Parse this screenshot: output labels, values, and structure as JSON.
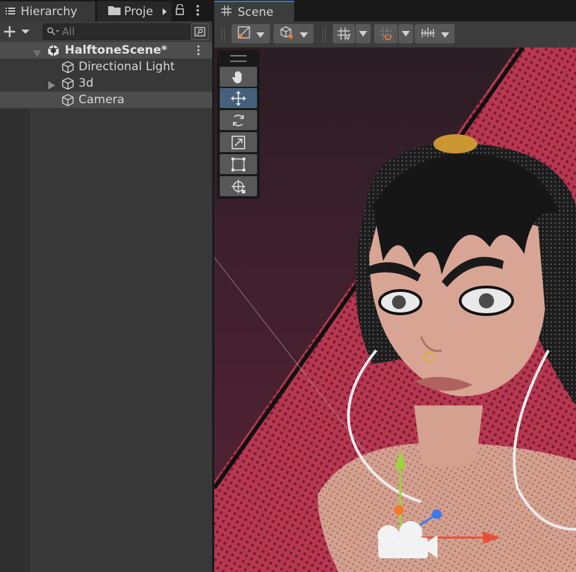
{
  "hierarchy": {
    "tab_label": "Hierarchy",
    "project_tab_label": "Proje",
    "search_placeholder": "All",
    "scene_name": "HalftoneScene*",
    "items": [
      {
        "label": "Directional Light"
      },
      {
        "label": "3d"
      },
      {
        "label": "Camera"
      }
    ]
  },
  "scene": {
    "tab_label": "Scene"
  },
  "icons": {
    "hierarchy_tab": "list-icon",
    "project_tab": "folder-icon",
    "scene_tab": "hash-icon",
    "lock": "lock-icon",
    "more": "kebab-icon",
    "add": "plus-icon",
    "search": "search-icon",
    "unity_scene": "unity-logo-icon",
    "gameobject": "cube-icon",
    "tools": [
      "hand-tool-icon",
      "move-tool-icon",
      "rotate-tool-icon",
      "scale-tool-icon",
      "rect-tool-icon",
      "transform-tool-icon"
    ]
  },
  "colors": {
    "selected_tool": "#46607c",
    "panel_bg": "#383838",
    "selection_row": "#4d4d4d",
    "gizmo_x": "#e8503a",
    "gizmo_y": "#9ad53c",
    "gizmo_z": "#3b7bf0"
  }
}
